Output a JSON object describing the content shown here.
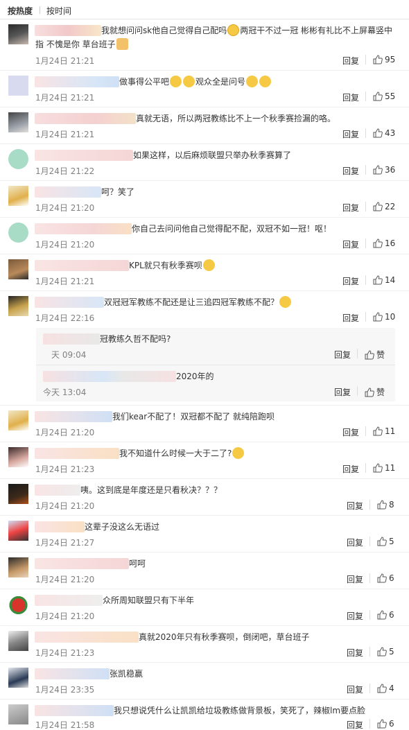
{
  "sort_tabs": [
    "按热度",
    "按时间"
  ],
  "reply_label": "回复",
  "zan_label": "赞",
  "comments": [
    {
      "text": "我就想问问sk他自己觉得自己配吗",
      "text2": "两冠干不过一冠 彬彬有礼比不上屏幕竖中",
      "line2": "指 不愧是你 草台班子",
      "time": "1月24日 21:21",
      "likes": "95"
    },
    {
      "text": "做事得公平吧",
      "text2": "观众全是问号",
      "time": "1月24日 21:21",
      "likes": "55"
    },
    {
      "text": "真就无语，所以两冠教练比不上一个秋季赛捡漏的咯。",
      "time": "1月24日 21:21",
      "likes": "43"
    },
    {
      "text": "如果这样，以后麻烦联盟只举办秋季赛算了",
      "time": "1月24日 21:22",
      "likes": "36"
    },
    {
      "text": "呵？笑了",
      "time": "1月24日 21:20",
      "likes": "22"
    },
    {
      "text": "你自己去问问他自己觉得配不配，双冠不如一冠！呕！",
      "time": "1月24日 21:20",
      "likes": "16"
    },
    {
      "text": "KPL就只有秋季赛呗",
      "time": "1月24日 21:21",
      "likes": "14"
    },
    {
      "text": "双冠冠军教练不配还是让三追四冠军教练不配？",
      "time": "1月24日 22:16",
      "likes": "10",
      "subs": [
        {
          "text": "冠教练久哲不配吗?",
          "time": "天 09:04"
        },
        {
          "text": "2020年的",
          "time": "今天 13:04"
        }
      ]
    },
    {
      "text": "我们kear不配了！双冠都不配了 就纯陪跑呗",
      "time": "1月24日 21:20",
      "likes": "11"
    },
    {
      "text": "我不知道什么时候一大于二了?",
      "time": "1月24日 21:23",
      "likes": "11"
    },
    {
      "text": "咦。这到底是年度还是只看秋决？？？",
      "time": "1月24日 21:20",
      "likes": "8"
    },
    {
      "text": "这辈子没这么无语过",
      "time": "1月24日 21:27",
      "likes": "5"
    },
    {
      "text": "呵呵",
      "time": "1月24日 21:20",
      "likes": "6"
    },
    {
      "text": "众所周知联盟只有下半年",
      "time": "1月24日 21:20",
      "likes": "6"
    },
    {
      "text": "真就2020年只有秋季赛呗，倒闭吧，草台班子",
      "time": "1月24日 21:23",
      "likes": "5"
    },
    {
      "text": "张凯稳赢",
      "time": "1月24日 23:35",
      "likes": "4"
    },
    {
      "text": "我只想说凭什么让凯凯给垃圾教练做背景板，笑死了，辣椒lm要点脸",
      "time": "1月24日 21:58",
      "likes": "6"
    }
  ],
  "colors": {
    "text": "#333333",
    "time": "#808080",
    "divider": "#eeeeee",
    "sub_bg": "#f7f7f7"
  }
}
